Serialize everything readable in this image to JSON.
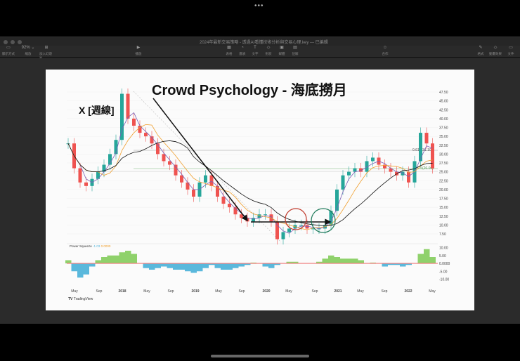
{
  "window": {
    "more_dots": "•••",
    "document_title": "2024年最新交易策略 - 透過AI看懂技術分析與交易心理.key — 已編輯"
  },
  "toolbar": {
    "items": [
      {
        "label": "顯示方式",
        "icon": "view-icon"
      },
      {
        "label": "縮放",
        "icon": "zoom-icon",
        "value": "92%"
      },
      {
        "label": "加入幻燈片",
        "icon": "add-slide-icon"
      },
      {
        "label": "播放",
        "icon": "play-icon"
      },
      {
        "label": "表格",
        "icon": "table-icon"
      },
      {
        "label": "圖表",
        "icon": "chart-icon"
      },
      {
        "label": "文字",
        "icon": "text-icon"
      },
      {
        "label": "形狀",
        "icon": "shape-icon"
      },
      {
        "label": "媒體",
        "icon": "media-icon"
      },
      {
        "label": "註解",
        "icon": "comment-icon"
      },
      {
        "label": "合作",
        "icon": "collaborate-icon"
      },
      {
        "label": "格式",
        "icon": "format-icon"
      },
      {
        "label": "動畫效果",
        "icon": "animate-icon"
      },
      {
        "label": "文件",
        "icon": "document-icon"
      }
    ]
  },
  "slide": {
    "title": "Crowd Psychology - 海底撈月",
    "subtitle": "X [週線]",
    "watermark": "TradingView",
    "indicator": {
      "name": "Power Squeeze",
      "value": "-1.03",
      "value2": "0.0000"
    },
    "fib_labels": [
      "0.618(31.10)",
      "0.5(26.06)"
    ]
  },
  "chart_data": {
    "type": "line",
    "title": "X weekly",
    "x_ticks": [
      "May",
      "Sep",
      "2018",
      "May",
      "Sep",
      "2019",
      "May",
      "Sep",
      "2020",
      "May",
      "Sep",
      "2021",
      "May",
      "Sep",
      "2022",
      "May"
    ],
    "y_ticks": [
      "47.50",
      "45.00",
      "42.50",
      "40.00",
      "37.50",
      "35.00",
      "32.50",
      "30.00",
      "27.50",
      "25.00",
      "22.50",
      "20.00",
      "17.50",
      "15.00",
      "12.50",
      "10.00",
      "7.50"
    ],
    "ylim": [
      5,
      47.5
    ],
    "price": [
      33,
      26,
      22,
      21,
      23,
      25,
      27,
      30,
      34,
      47,
      40,
      38,
      36,
      35,
      33,
      30,
      28,
      27,
      24,
      22,
      20,
      18,
      22,
      24,
      21,
      18,
      16,
      15,
      13,
      12,
      11,
      12,
      13,
      13,
      11,
      6,
      8,
      9,
      10,
      10,
      9,
      9,
      9,
      10,
      14,
      20,
      24,
      25,
      26,
      25,
      28,
      29,
      27,
      26,
      25,
      24,
      25,
      22,
      28,
      36,
      33,
      26
    ],
    "squeeze_ticks": [
      "10.00",
      "5.00",
      "0.0000",
      "-5.00",
      "-10.00"
    ],
    "squeeze": [
      2,
      -5,
      -9,
      -7,
      -2,
      2,
      4,
      5,
      5,
      7,
      8,
      6,
      0,
      -3,
      -4,
      -3,
      -2,
      -3,
      -4,
      -4,
      -5,
      -6,
      -5,
      -3,
      -1,
      -3,
      -4,
      -4,
      -3,
      -2,
      -1,
      0.5,
      0,
      -2,
      -3,
      -1,
      0,
      1,
      1,
      0,
      0,
      0,
      1,
      3,
      5,
      4,
      3,
      3,
      3,
      2,
      0,
      0.5,
      0,
      -2,
      -1,
      -1,
      -2,
      -1,
      0,
      6,
      9,
      4
    ],
    "colors": {
      "up": "#26a69a",
      "down": "#ef5350",
      "ma1": "#7b5fb5",
      "ma2": "#f0a030",
      "ma3": "#111111",
      "sq_pos": "#8fd16b",
      "sq_neg": "#5ab8dc"
    }
  }
}
